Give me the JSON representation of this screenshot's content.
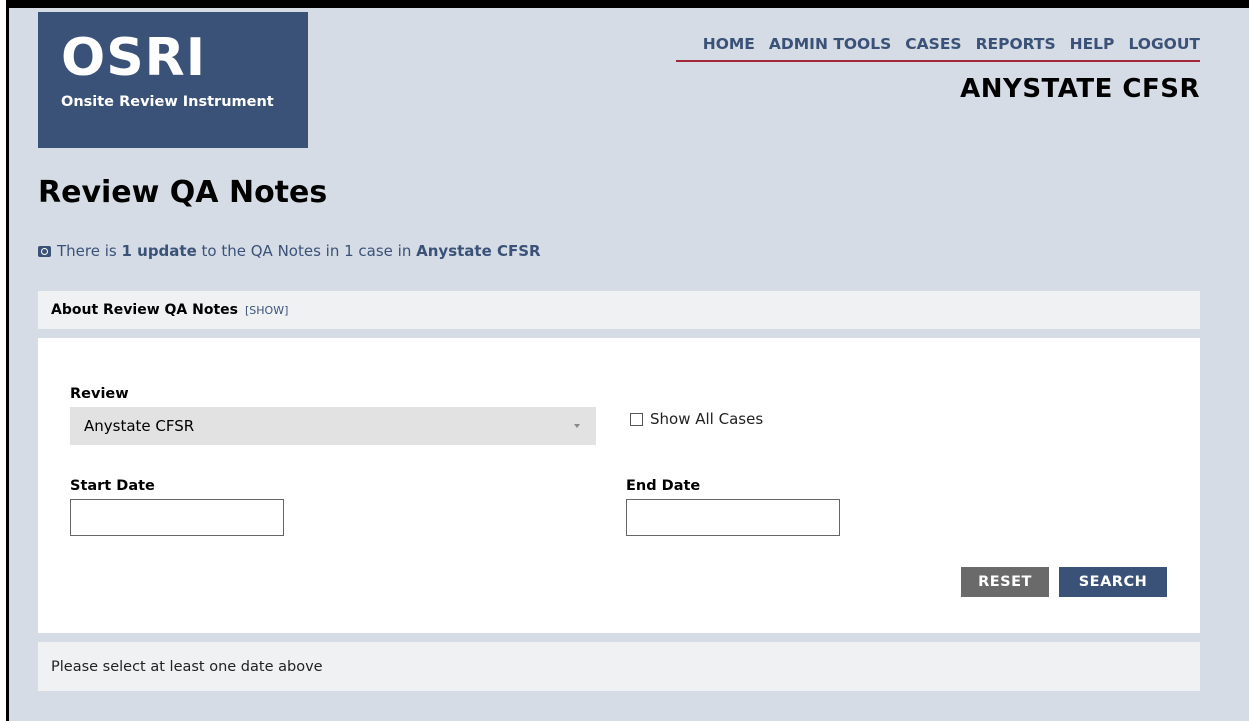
{
  "logo": {
    "title": "OSRI",
    "subtitle": "Onsite Review Instrument"
  },
  "nav": {
    "items": [
      "HOME",
      "ADMIN TOOLS",
      "CASES",
      "REPORTS",
      "HELP",
      "LOGOUT"
    ]
  },
  "state_title": "ANYSTATE CFSR",
  "page_title": "Review QA Notes",
  "update": {
    "prefix": "There is ",
    "count": "1 update",
    "middle": " to the QA Notes in 1 case in ",
    "review": "Anystate CFSR"
  },
  "about": {
    "label": "About Review QA Notes",
    "toggle": "[SHOW]"
  },
  "form": {
    "review_label": "Review",
    "review_value": "Anystate CFSR",
    "show_all_label": "Show All Cases",
    "show_all_checked": false,
    "start_date_label": "Start Date",
    "start_date_value": "",
    "end_date_label": "End Date",
    "end_date_value": "",
    "reset_label": "RESET",
    "search_label": "SEARCH"
  },
  "message": "Please select at least one date above",
  "colors": {
    "primary": "#3b5278",
    "accent": "#a1283a",
    "background": "#d5dce5"
  }
}
